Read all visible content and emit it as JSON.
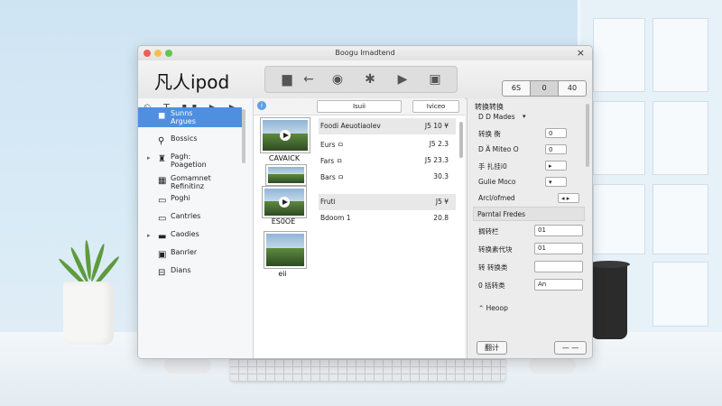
{
  "window": {
    "title": "Boogu Imadtend",
    "close": "×"
  },
  "toolbar": {
    "app_name": "凡人ipod",
    "segmented": [
      "6S",
      "0",
      "40"
    ],
    "segmented_selected": 1
  },
  "sidebar": {
    "tool_icons": "⏲ T ▮▮ ▶ ▶ ╲",
    "items": [
      {
        "label": "Sunns\nArgues",
        "icon": "◼",
        "selected": true,
        "arrow": ""
      },
      {
        "label": "Bossics",
        "icon": "⚲",
        "selected": false,
        "arrow": ""
      },
      {
        "label": "Pagh:\nPoagetion",
        "icon": "♜",
        "selected": false,
        "arrow": "▸"
      },
      {
        "label": "Gomamnet\nRefinitinz",
        "icon": "▦",
        "selected": false,
        "arrow": ""
      },
      {
        "label": "Poghi",
        "icon": "▭",
        "selected": false,
        "arrow": ""
      },
      {
        "label": "Cantrles",
        "icon": "▭",
        "selected": false,
        "arrow": ""
      },
      {
        "label": "Caodies",
        "icon": "▬",
        "selected": false,
        "arrow": "▸"
      },
      {
        "label": "Banrler",
        "icon": "▣",
        "selected": false,
        "arrow": ""
      },
      {
        "label": "Dians",
        "icon": "⊟",
        "selected": false,
        "arrow": ""
      }
    ]
  },
  "content": {
    "header_left": "Isuii",
    "header_right": "Iviceo",
    "info_icon": "i",
    "thumb_captions": [
      "CAVAICK",
      "ES0OE",
      "eii"
    ],
    "rows": [
      {
        "name": "Foodi Aeuotiaolev",
        "size": "J5 10 ¥",
        "selected": true
      },
      {
        "name": "Eurs ㅁ",
        "size": "J5 2.3",
        "selected": false
      },
      {
        "name": "Fars ㅁ",
        "size": "J5 23.3",
        "selected": false
      },
      {
        "name": "Bars ㅁ",
        "size": "30.3",
        "selected": false
      },
      {
        "name": "Fruti",
        "size": "J5 ¥",
        "selected": true
      },
      {
        "name": "Bdoom 1",
        "size": "20.8",
        "selected": false
      }
    ]
  },
  "inspector": {
    "title": "转换转换",
    "rows": [
      {
        "label": "D D Mades",
        "value": "▾"
      },
      {
        "label": "转换 衡",
        "value": "0"
      },
      {
        "label": "D Ä Miteo O",
        "value": "0"
      },
      {
        "label": "手 扎挂i0",
        "value": "▸"
      },
      {
        "label": "Gulie Moco",
        "value": "▾"
      },
      {
        "label": "Arcl/ofmed",
        "value": "◂ ▸"
      }
    ],
    "section1": "Parntal Fredes",
    "rows2": [
      {
        "label": "搁转栏",
        "value": "01"
      },
      {
        "label": "转换素代块",
        "value": "01"
      },
      {
        "label": "转 转换类",
        "value": ""
      },
      {
        "label": "0 括转类",
        "value": "An"
      }
    ],
    "section2": "Heoop",
    "bottom_btn_left": "翻计",
    "bottom_btn_right": "— —"
  }
}
